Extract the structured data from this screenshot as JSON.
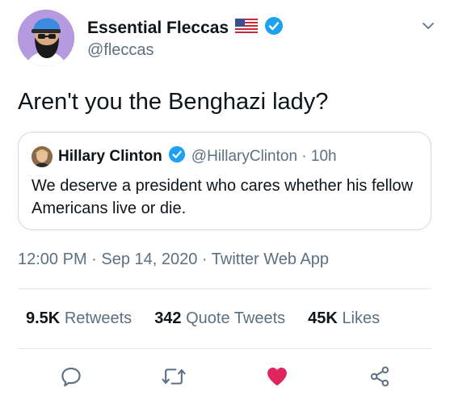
{
  "tweet": {
    "author": {
      "display_name": "Essential Fleccas",
      "handle": "@fleccas",
      "flag_icon": "us-flag-icon",
      "verified_icon": "verified-badge-icon"
    },
    "text": "Aren't you the Benghazi lady?",
    "quoted": {
      "display_name": "Hillary Clinton",
      "handle_time": "@HillaryClinton · 10h",
      "text": "We deserve a president who cares whether his fellow Americans live or die."
    },
    "timestamp": "12:00 PM · Sep 14, 2020 · Twitter Web App",
    "stats": {
      "retweets_count": "9.5K",
      "retweets_label": "Retweets",
      "quotes_count": "342",
      "quotes_label": "Quote Tweets",
      "likes_count": "45K",
      "likes_label": "Likes"
    },
    "actions": {
      "reply_icon": "reply-icon",
      "retweet_icon": "retweet-icon",
      "like_icon": "heart-icon",
      "share_icon": "share-icon",
      "liked_color": "#e0245e"
    }
  },
  "colors": {
    "accent": "#1da1f2",
    "secondary_text": "#5b7083",
    "border": "#cfd9de"
  }
}
